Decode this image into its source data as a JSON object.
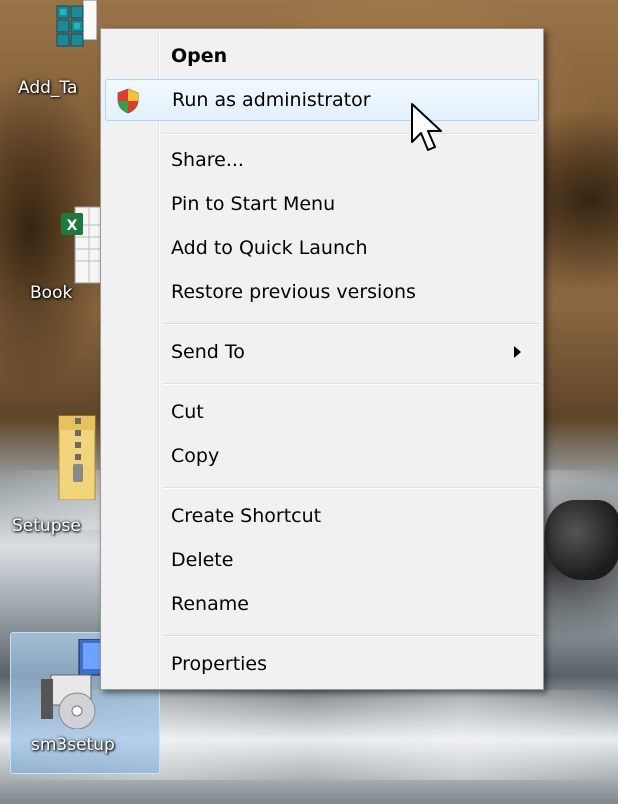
{
  "desktop": {
    "icons": [
      {
        "label": "Add_Ta",
        "icon": "cube-icon"
      },
      {
        "label": "Book",
        "icon": "spreadsheet-icon"
      },
      {
        "label": "Setupse",
        "icon": "zip-folder-icon"
      },
      {
        "label": "sm3setup",
        "icon": "installer-icon",
        "selected": true
      }
    ]
  },
  "context_menu": {
    "items": {
      "open": "Open",
      "run_as_admin": "Run as administrator",
      "share": "Share...",
      "pin_start": "Pin to Start Menu",
      "quick_launch": "Add to Quick Launch",
      "restore": "Restore previous versions",
      "send_to": "Send To",
      "cut": "Cut",
      "copy": "Copy",
      "create_shortcut": "Create Shortcut",
      "delete": "Delete",
      "rename": "Rename",
      "properties": "Properties"
    },
    "hovered": "run_as_admin",
    "colors": {
      "hover_border": "#a8d8f5",
      "menu_bg": "#f1f1f1"
    }
  }
}
